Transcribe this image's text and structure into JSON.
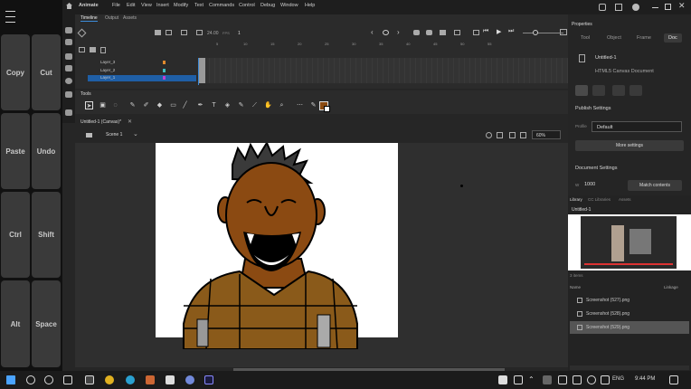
{
  "keypad": {
    "keys": [
      {
        "label": "Copy"
      },
      {
        "label": "Cut"
      },
      {
        "label": "Paste"
      },
      {
        "label": "Undo"
      },
      {
        "label": "Ctrl"
      },
      {
        "label": "Shift"
      },
      {
        "label": "Alt"
      },
      {
        "label": "Space"
      }
    ]
  },
  "app": {
    "name": "Animate",
    "menu": [
      "File",
      "Edit",
      "View",
      "Insert",
      "Modify",
      "Text",
      "Commands",
      "Control",
      "Debug",
      "Window",
      "Help"
    ]
  },
  "timeline": {
    "tabs": [
      "Timeline",
      "Output",
      "Assets"
    ],
    "fps": "24.00",
    "fps_unit": "FPS",
    "frame": "1",
    "frame_numbers": [
      "5",
      "10",
      "15",
      "20",
      "25",
      "30",
      "35",
      "40",
      "45",
      "50",
      "55"
    ],
    "layers": [
      "Layer_3",
      "Layer_2",
      "Layer_1"
    ]
  },
  "tools": {
    "title": "Tools"
  },
  "document": {
    "tab": "Untitled-1 (Canvas)*",
    "scene": "Scene 1",
    "zoom": "60%"
  },
  "properties": {
    "title": "Properties",
    "tabs": [
      "Tool",
      "Object",
      "Frame",
      "Doc"
    ],
    "doc_name": "Untitled-1",
    "doc_type": "HTML5 Canvas Document",
    "publish_settings": "Publish Settings",
    "profile_label": "Profile",
    "profile_value": "Default",
    "more_settings": "More settings",
    "document_settings": "Document Settings",
    "width_label": "W",
    "width_value": "1000",
    "match_contents": "Match contents"
  },
  "library": {
    "tabs": [
      "Library",
      "CC Libraries",
      "Assets"
    ],
    "doc": "Untitled-1",
    "count": "3 items",
    "name_col": "Name",
    "linkage_col": "Linkage",
    "items": [
      "Screenshot (527).png",
      "Screenshot (528).png",
      "Screenshot (529).png"
    ]
  },
  "taskbar": {
    "lang": "ENG",
    "time": "9:44 PM"
  },
  "colors": {
    "accent": "#3d8bd8",
    "fill": "#8a4a10",
    "skin": "#8b4a12"
  }
}
